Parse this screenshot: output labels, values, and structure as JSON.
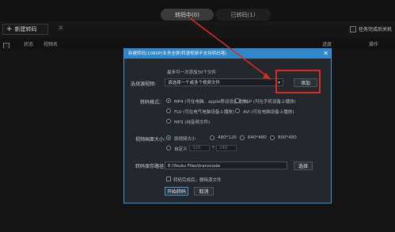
{
  "top_tabs": {
    "converting": "转码中(0)",
    "done": "已转码(1)"
  },
  "toolbar": {
    "new_label": "新建转码",
    "task_option": "任务完成后关机"
  },
  "table_headers": {
    "status": "状态",
    "video_name": "视频名",
    "progress": "进度",
    "action": "操作"
  },
  "dialog": {
    "title": "新建转码(1080P/业务全屏/转速视频不支持转码哦)",
    "max_hint": "最多可一次添加30个文件",
    "choose_label": "选择源视频:",
    "choose_placeholder": "请选择一个或多个视频文件",
    "add_button": "添加",
    "format_label": "转码格式:",
    "formats": [
      "MP4 (可在电脑、apple移动设备播放)",
      "3GP (可在手机设备上播放)",
      "FLV (可在电气电脑设备上播放)",
      "AVI (可在电脑设备上播放)",
      "MP3 (纯音频文件)"
    ],
    "size_label": "视频画面大小:",
    "sizes": [
      "原视频大小",
      "480*120",
      "640*480",
      "800*480"
    ],
    "custom_label": "自定义",
    "custom_width": "320",
    "custom_height": "240",
    "path_label": "转码保存路径:",
    "path_value": "E:\\Youku Files\\transcode",
    "browse_button": "选择",
    "delete_after": "转码完成后，删除源文件",
    "start_button": "开始转码",
    "cancel_button": "取消"
  },
  "colors": {
    "accent": "#3b95d6",
    "highlight": "#d42b2b"
  }
}
